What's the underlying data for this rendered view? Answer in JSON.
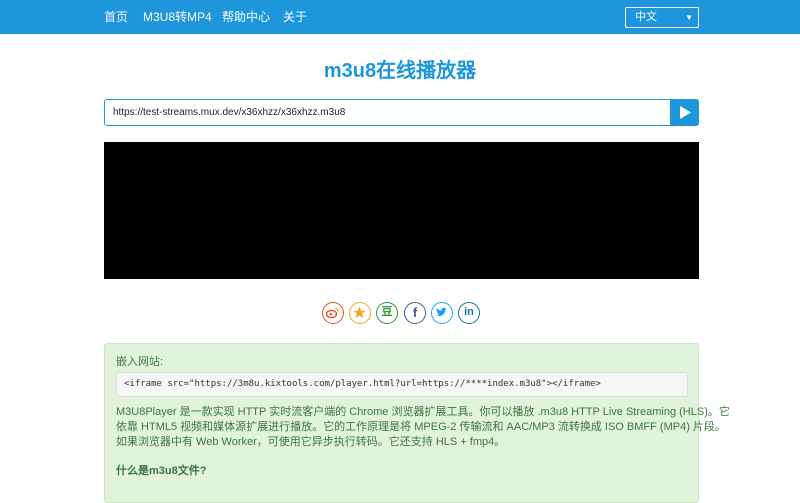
{
  "nav": {
    "items": [
      "首页",
      "M3U8转MP4",
      "帮助中心",
      "关于"
    ],
    "language": "中文"
  },
  "page": {
    "title": "m3u8在线播放器"
  },
  "player": {
    "url": "https://test-streams.mux.dev/x36xhzz/x36xhzz.m3u8"
  },
  "share": {
    "icons": [
      "weibo-icon",
      "qzone-icon",
      "douban-icon",
      "facebook-icon",
      "twitter-icon",
      "linkedin-icon"
    ],
    "douban_glyph": "豆",
    "facebook_glyph": "f",
    "linkedin_glyph": "in"
  },
  "info": {
    "embed_label": "嵌入网站:",
    "embed_code": "<iframe src=\"https://3m8u.kixtools.com/player.html?url=https://****index.m3u8\"></iframe>",
    "description_lines": [
      "M3U8Player 是一款实现 HTTP 实时流客户端的 Chrome 浏览器扩展工具。你可以播放 .m3u8 HTTP Live Streaming (HLS)。它",
      "依靠 HTML5 视频和媒体源扩展进行播放。它的工作原理是将 MPEG-2 传输流和 AAC/MP3 流转换成 ISO BMFF (MP4) 片段。",
      "如果浏览器中有 Web Worker，可使用它异步执行转码。它还支持 HLS + fmp4。"
    ],
    "faq_title": "什么是m3u8文件?"
  },
  "colors": {
    "brand": "#1d96dc",
    "info_bg": "#e2f3dc",
    "info_text": "#3c763d"
  }
}
